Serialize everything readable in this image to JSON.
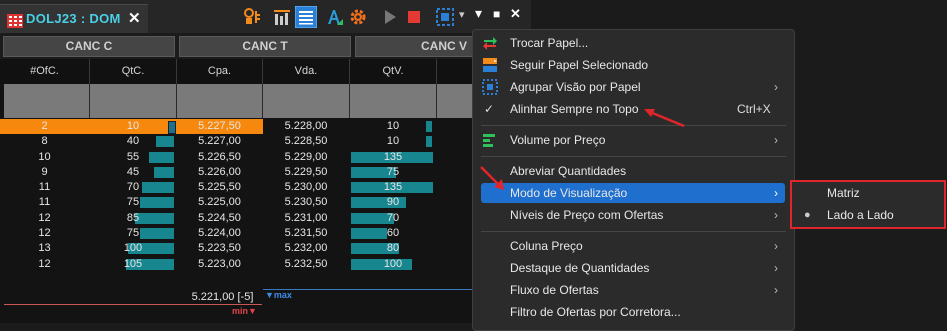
{
  "window": {
    "title": "DOLJ23 : DOM",
    "close_glyph": "✕"
  },
  "toolbar": {
    "icons": [
      "person-key-icon",
      "bar-chart-icon",
      "list-icon",
      "font-color-icon",
      "gear-icon",
      "play-icon",
      "stop-icon",
      "selection-icon",
      "pin-icon",
      "maximize-icon",
      "close-icon"
    ],
    "dropdown_glyph": "▾",
    "pin_glyph": "▾",
    "max_glyph": "■",
    "close_glyph": "✕"
  },
  "cancel_buttons": [
    "CANC C",
    "CANC T",
    "CANC V"
  ],
  "columns": [
    "#OfC.",
    "QtC.",
    "Cpa.",
    "Vda.",
    "QtV.",
    "#"
  ],
  "rows": [
    {
      "ofc": "2",
      "qtc": "10",
      "cpa": "5.227,50",
      "vda": "5.228,00",
      "qtv": "10",
      "buy_bar": 0.07,
      "sell_bar": 0.07
    },
    {
      "ofc": "8",
      "qtc": "40",
      "cpa": "5.227,00",
      "vda": "5.228,50",
      "qtv": "10",
      "buy_bar": 0.3,
      "sell_bar": 0.07
    },
    {
      "ofc": "10",
      "qtc": "55",
      "cpa": "5.226,50",
      "vda": "5.229,00",
      "qtv": "135",
      "buy_bar": 0.42,
      "sell_bar": 1.0
    },
    {
      "ofc": "9",
      "qtc": "45",
      "cpa": "5.226,00",
      "vda": "5.229,50",
      "qtv": "75",
      "buy_bar": 0.34,
      "sell_bar": 0.55
    },
    {
      "ofc": "11",
      "qtc": "70",
      "cpa": "5.225,50",
      "vda": "5.230,00",
      "qtv": "135",
      "buy_bar": 0.53,
      "sell_bar": 1.0
    },
    {
      "ofc": "11",
      "qtc": "75",
      "cpa": "5.225,00",
      "vda": "5.230,50",
      "qtv": "90",
      "buy_bar": 0.57,
      "sell_bar": 0.67
    },
    {
      "ofc": "12",
      "qtc": "85",
      "cpa": "5.224,50",
      "vda": "5.231,00",
      "qtv": "70",
      "buy_bar": 0.65,
      "sell_bar": 0.52
    },
    {
      "ofc": "12",
      "qtc": "75",
      "cpa": "5.224,00",
      "vda": "5.231,50",
      "qtv": "60",
      "buy_bar": 0.57,
      "sell_bar": 0.44
    },
    {
      "ofc": "13",
      "qtc": "100",
      "cpa": "5.223,50",
      "vda": "5.232,00",
      "qtv": "80",
      "buy_bar": 0.76,
      "sell_bar": 0.59
    },
    {
      "ofc": "12",
      "qtc": "105",
      "cpa": "5.223,00",
      "vda": "5.232,50",
      "qtv": "100",
      "buy_bar": 0.8,
      "sell_bar": 0.74
    }
  ],
  "footer": {
    "last_price": "5.221,00 [-5]",
    "max_label": "▼max",
    "min_label": "min▼"
  },
  "colors": {
    "accent": "#1f6fce",
    "bar": "#17868f",
    "highlight": "#f5880d",
    "annotation": "#e0262a"
  },
  "menu": {
    "items": [
      {
        "label": "Trocar Papel...",
        "icon": "swap-icon"
      },
      {
        "label": "Seguir Papel Selecionado",
        "icon": "follow-icon"
      },
      {
        "label": "Agrupar Visão por Papel",
        "icon": "group-icon",
        "arrow": "›"
      },
      {
        "label": "Alinhar Sempre no Topo",
        "icon": "check-icon",
        "check": "✓",
        "shortcut": "Ctrl+X"
      },
      {
        "label": "Volume por Preço",
        "icon": "volume-icon",
        "arrow": "›"
      },
      {
        "label": "Abreviar Quantidades"
      },
      {
        "label": "Modo de Visualização",
        "arrow": "›",
        "selected": true
      },
      {
        "label": "Níveis de Preço com Ofertas",
        "arrow": "›"
      },
      {
        "label": "Coluna Preço",
        "arrow": "›"
      },
      {
        "label": "Destaque de Quantidades",
        "arrow": "›"
      },
      {
        "label": "Fluxo de Ofertas",
        "arrow": "›"
      },
      {
        "label": "Filtro de Ofertas por Corretora..."
      }
    ]
  },
  "submenu": {
    "items": [
      {
        "label": "Matriz",
        "checked": false
      },
      {
        "label": "Lado a Lado",
        "checked": true,
        "bullet": "●"
      }
    ]
  }
}
